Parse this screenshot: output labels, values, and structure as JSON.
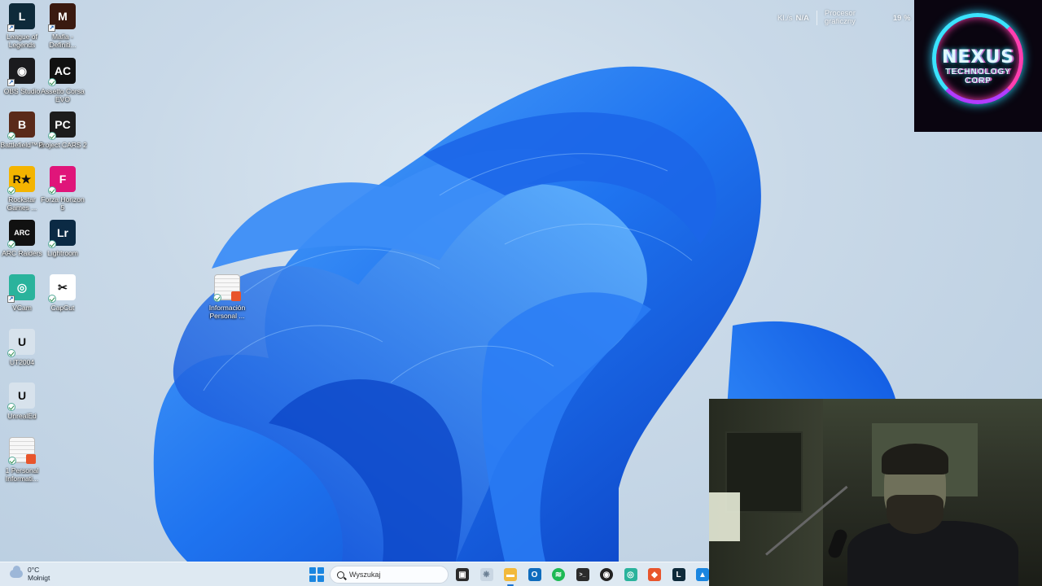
{
  "desktop_icons": [
    {
      "label": "League of Legends",
      "icon": "league-of-legends-icon",
      "color": "#0e2a3a",
      "glyph": "L"
    },
    {
      "label": "Mafia - Definiti...",
      "icon": "mafia-icon",
      "color": "#3a1a10",
      "glyph": "M"
    },
    {
      "label": "OBS Studio",
      "icon": "obs-studio-icon",
      "color": "#1b1b1e",
      "glyph": "◉"
    },
    {
      "label": "Assetto Corsa EVO",
      "icon": "assetto-corsa-icon",
      "color": "#111111",
      "glyph": "AC"
    },
    {
      "label": "Battlefield™ 6",
      "icon": "battlefield-icon",
      "color": "#5a2a1a",
      "glyph": "B"
    },
    {
      "label": "Project CARS 2",
      "icon": "project-cars-icon",
      "color": "#1c1c1c",
      "glyph": "PC"
    },
    {
      "label": "Rockstar Games ...",
      "icon": "rockstar-games-icon",
      "color": "#f4b400",
      "glyph": "R★"
    },
    {
      "label": "Forza Horizon 5",
      "icon": "forza-horizon-icon",
      "color": "#e0157a",
      "glyph": "F"
    },
    {
      "label": "ARC Raiders",
      "icon": "arc-raiders-icon",
      "color": "#111111",
      "glyph": "ARC"
    },
    {
      "label": "Lightroom",
      "icon": "lightroom-icon",
      "color": "#0b2a44",
      "glyph": "Lr"
    },
    {
      "label": "VCam",
      "icon": "vcam-icon",
      "color": "#2ab39c",
      "glyph": "◎"
    },
    {
      "label": "CapCut",
      "icon": "capcut-icon",
      "color": "#ffffff",
      "glyph": "✂"
    },
    {
      "label": "UT2004",
      "icon": "ut2004-icon",
      "color": "#d7e2ec",
      "glyph": "U"
    },
    {
      "label": "UnrealEd",
      "icon": "unrealed-icon",
      "color": "#d7e2ec",
      "glyph": "U"
    },
    {
      "label": "1 Personal Informati...",
      "icon": "document-icon",
      "color": "#f5f5f5",
      "glyph": ""
    },
    {
      "label": "Información Personal ...",
      "icon": "document-icon",
      "color": "#f5f5f5",
      "glyph": ""
    }
  ],
  "perf_overlay": {
    "net_label": "Kl./s",
    "net_value": "N/A",
    "gpu_label_1": "Procesor",
    "gpu_label_2": "graficzny",
    "gpu_value": "19 %"
  },
  "logo": {
    "line1": "NEXUS",
    "line2": "TECHNOLOGY",
    "line3": "CORP"
  },
  "taskbar": {
    "weather_temp": "0°C",
    "weather_desc": "Mołnigt",
    "search_placeholder": "Wyszukaj",
    "pinned": [
      {
        "icon": "task-view-icon",
        "color": "#2b2b2b",
        "glyph": "▣"
      },
      {
        "icon": "widgets-icon",
        "color": "#c9d6e3",
        "glyph": "❋"
      },
      {
        "icon": "file-explorer-icon",
        "color": "#f2b93b",
        "glyph": "▬"
      },
      {
        "icon": "outlook-icon",
        "color": "#0f6cbd",
        "glyph": "O"
      },
      {
        "icon": "spotify-icon",
        "color": "#1db954",
        "glyph": "≋"
      },
      {
        "icon": "terminal-icon",
        "color": "#2b2b2b",
        "glyph": ">_"
      },
      {
        "icon": "obs-studio-icon",
        "color": "#222222",
        "glyph": "◉"
      },
      {
        "icon": "vcam-icon",
        "color": "#2ab39c",
        "glyph": "◎"
      },
      {
        "icon": "git-icon",
        "color": "#e8552c",
        "glyph": "◆"
      },
      {
        "icon": "league-of-legends-icon",
        "color": "#0e2a3a",
        "glyph": "L"
      },
      {
        "icon": "photos-icon",
        "color": "#1a86e0",
        "glyph": "▲"
      }
    ]
  }
}
